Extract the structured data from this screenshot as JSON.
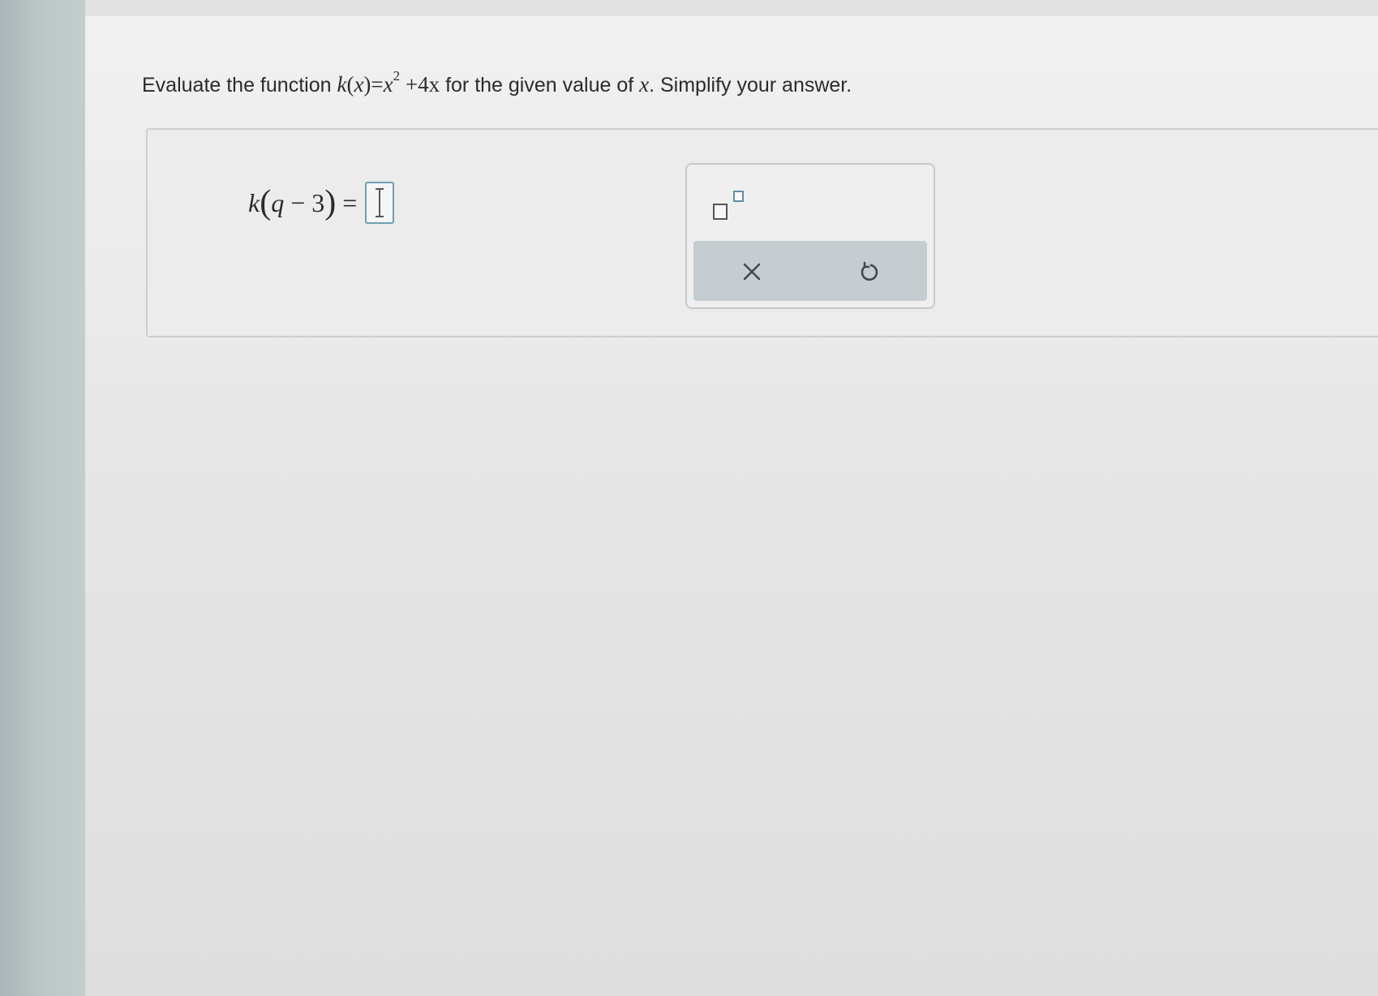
{
  "question": {
    "text_before": "Evaluate the function",
    "function_name": "k",
    "variable": "x",
    "equals": "=",
    "base": "x",
    "exponent": "2",
    "plus_term": "+4x",
    "text_middle": "for the given value of",
    "variable_end": "x",
    "text_after": ". Simplify your answer."
  },
  "answer": {
    "function_name": "k",
    "arg_var": "q",
    "minus": "−",
    "arg_num": "3",
    "equals": "=",
    "value": ""
  },
  "toolbox": {
    "exponent_button": "superscript-template",
    "clear_icon": "close-icon",
    "undo_icon": "undo-icon"
  },
  "colors": {
    "input_border": "#6f9fb4",
    "toolbar_bar": "#c6cdd0"
  }
}
